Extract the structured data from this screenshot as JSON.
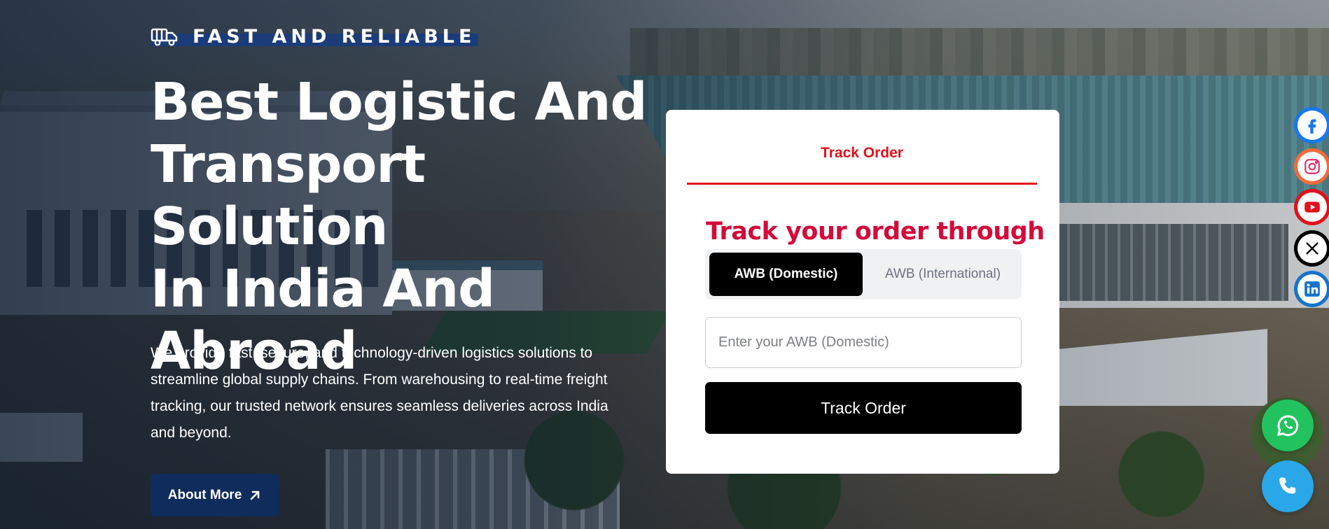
{
  "hero": {
    "tagline": "FAST AND RELIABLE",
    "title_lines": [
      "Best Logistic And",
      "Transport Solution",
      "In India And",
      "Abroad"
    ],
    "description_lines": [
      "We provide fast, secure, and technology-driven logistics solutions to",
      "streamline global supply chains. From warehousing to real-time freight",
      "tracking, our trusted network ensures seamless deliveries across India",
      "and beyond."
    ],
    "about_button_label": "About More"
  },
  "track_card": {
    "tab_label": "Track Order",
    "heading": "Track your order through",
    "options": [
      "AWB (Domestic)",
      "AWB (International)"
    ],
    "selected_option": "AWB (Domestic)",
    "input_placeholder": "Enter your AWB (Domestic)",
    "submit_label": "Track Order"
  },
  "social_links": [
    {
      "name": "facebook-icon",
      "color": "#1877f2"
    },
    {
      "name": "instagram-icon",
      "color": "#f26b3a"
    },
    {
      "name": "youtube-icon",
      "color": "#e1111b"
    },
    {
      "name": "x-icon",
      "color": "#000000"
    },
    {
      "name": "linkedin-icon",
      "color": "#1673c9"
    }
  ],
  "floating_buttons": [
    {
      "name": "whatsapp-icon",
      "color": "#22c35e"
    },
    {
      "name": "phone-icon",
      "color": "#2aa7e8"
    }
  ],
  "colors": {
    "accent_red": "#e3121a",
    "heading_crimson": "#d30b3a",
    "navy": "#0f2c5c",
    "tagline_highlight": "#1b3c78"
  }
}
